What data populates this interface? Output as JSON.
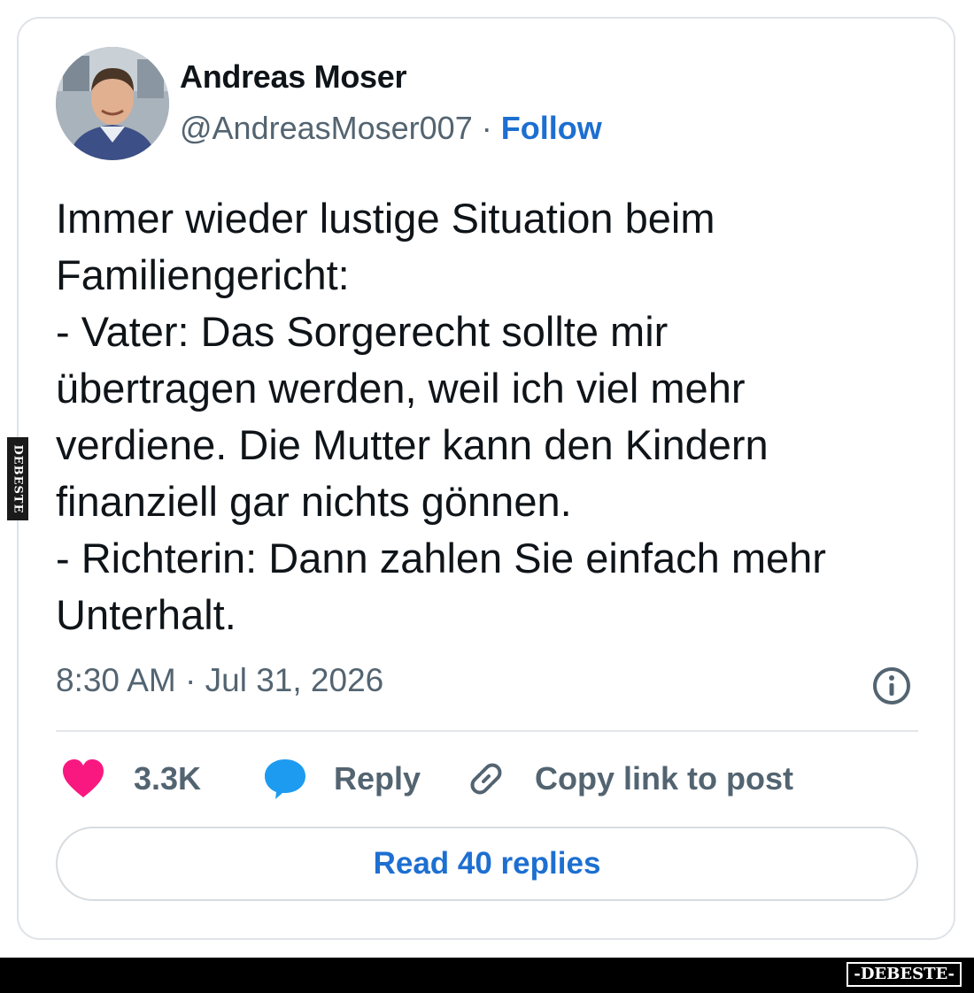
{
  "author": {
    "name": "Andreas Moser",
    "handle": "@AndreasMoser007",
    "separator": " · ",
    "follow_label": "Follow"
  },
  "tweet": {
    "text": "Immer wieder lustige Situation beim\nFamiliengericht:\n- Vater: Das Sorgerecht sollte mir\nübertragen werden, weil ich viel mehr\nverdiene. Die Mutter kann den Kindern\nfinanziell gar nichts gönnen.\n- Richterin: Dann zahlen Sie einfach mehr\nUnterhalt.",
    "timestamp": "8:30 AM · Jul 31, 2026"
  },
  "actions": {
    "likes_count": "3.3K",
    "reply_label": "Reply",
    "copy_link_label": "Copy link to post"
  },
  "read_replies_label": "Read 40 replies",
  "watermark": {
    "side_text": "DEBESTE",
    "logo_text": "-DEBESTE-"
  },
  "colors": {
    "accent_blue": "#1d6fd1",
    "heart_pink": "#f91880",
    "reply_bubble_blue": "#1d9bf0",
    "text_primary": "#0f1419",
    "text_secondary": "#536471"
  },
  "icons": {
    "info": "info-circle-icon",
    "like": "heart-icon",
    "reply": "speech-bubble-icon",
    "copy_link": "link-icon"
  }
}
